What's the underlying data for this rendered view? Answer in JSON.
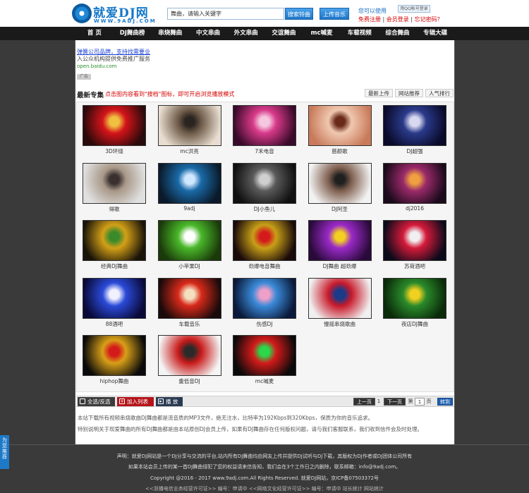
{
  "header": {
    "logo_text": "就爱DJ网",
    "logo_url_text": "WWW.9ADJ.COM",
    "search_value": "舞曲，请输入关键字",
    "search_button": "搜索铃曲",
    "upload_button": "上传音乐",
    "login_prompt": "您可以使用",
    "qq_login": "用QQ帐号登录",
    "register": "免费注册",
    "sep": "|",
    "member_login": "会员登录",
    "forgot": "忘记密码？"
  },
  "nav": [
    "首 页",
    "DJ舞曲榜",
    "串烧舞曲",
    "中文串曲",
    "外文串曲",
    "交谊舞曲",
    "mc喊麦",
    "车载视频",
    "综合舞曲",
    "专辑大碟"
  ],
  "ad": {
    "line1": "弹簧公司品牌，支持找需要业",
    "line2": "入公众机构提供免费推广服务",
    "line3": "open.baidu.com",
    "tag": "广告"
  },
  "section": {
    "title": "最新专集",
    "hint": "点击图内容看到\"搜档\"图标，即可开启浏览播放模式",
    "tabs": [
      "最新上传",
      "网站推荐",
      "人气排行"
    ]
  },
  "albums": [
    {
      "label": "3D环绕",
      "c1": "#2a0a0a",
      "c2": "#d4141a",
      "c3": "#f0c040"
    },
    {
      "label": "mc洪亮",
      "c1": "#e8ddd0",
      "c2": "#6e5a48",
      "c3": "#2a2420"
    },
    {
      "label": "7禾电音",
      "c1": "#3a0a2a",
      "c2": "#d83a8a",
      "c3": "#f6c8e0"
    },
    {
      "label": "慈颜歌",
      "c1": "#c87a5a",
      "c2": "#f0c8b0",
      "c3": "#6a2a1a"
    },
    {
      "label": "DJ超强",
      "c1": "#0a0a2a",
      "c2": "#2a3a8a",
      "c3": "#d8d8f0"
    },
    {
      "label": "得歌",
      "c1": "#e0e0e0",
      "c2": "#a89888",
      "c3": "#3a3030"
    },
    {
      "label": "9adj",
      "c1": "#0a1a2a",
      "c2": "#1a6aa8",
      "c3": "#d0e8ff"
    },
    {
      "label": "DJ小鱼儿",
      "c1": "#101010",
      "c2": "#5a5a5a",
      "c3": "#d0d0d0"
    },
    {
      "label": "DJ阿圣",
      "c1": "#f2f2f2",
      "c2": "#806050",
      "c3": "#202020"
    },
    {
      "label": "dj2016",
      "c1": "#1a0a1a",
      "c2": "#9a2a6a",
      "c3": "#f0a040"
    },
    {
      "label": "经典DJ舞曲",
      "c1": "#1a1408",
      "c2": "#d4a018",
      "c3": "#3a8a2a"
    },
    {
      "label": "小苹果DJ",
      "c1": "#1a3a0a",
      "c2": "#4ab82a",
      "c3": "#ffffff"
    },
    {
      "label": "劲爆电音舞曲",
      "c1": "#1a0a0a",
      "c2": "#c8a018",
      "c3": "#d41a1a"
    },
    {
      "label": "DJ舞曲 超劲爆",
      "c1": "#2a0a3a",
      "c2": "#9a2ac8",
      "c3": "#f4d020"
    },
    {
      "label": "苏荷酒吧",
      "c1": "#0a0a1a",
      "c2": "#d41a3a",
      "c3": "#f0f0f0"
    },
    {
      "label": "88酒吧",
      "c1": "#0a0a3a",
      "c2": "#2a4ad8",
      "c3": "#f0f0ff"
    },
    {
      "label": "车载音乐",
      "c1": "#1a0a0a",
      "c2": "#d82a1a",
      "c3": "#f4e0c0"
    },
    {
      "label": "伤感DJ",
      "c1": "#0a1a3a",
      "c2": "#3a8ad8",
      "c3": "#f0a0c8"
    },
    {
      "label": "慢摇串烧歌曲",
      "c1": "#f0f0f0",
      "c2": "#c81a2a",
      "c3": "#1a3a8a"
    },
    {
      "label": "夜店DJ舞曲",
      "c1": "#0a2a0a",
      "c2": "#2a8a2a",
      "c3": "#f0d020"
    },
    {
      "label": "hiphop舞曲",
      "c1": "#0a0a0a",
      "c2": "#d8a018",
      "c3": "#d41a1a"
    },
    {
      "label": "重低音DJ",
      "c1": "#f4f4f4",
      "c2": "#c81a1a",
      "c3": "#2a2a2a"
    },
    {
      "label": "mc喊麦",
      "c1": "#0a0a0a",
      "c2": "#d41a1a",
      "c3": "#2ad84a"
    }
  ],
  "toolbar": {
    "select_all": "全选/反选",
    "add_list": "加入列表",
    "play": "播 放",
    "prev": "上一页",
    "page_current": "1",
    "next": "下一页",
    "goto_prefix": "第",
    "goto_value": "1",
    "goto_suffix": "页",
    "go": "转到"
  },
  "notice": {
    "line1": "本站下载所有视频串烧歌曲DJ舞曲都是流音质的MP3文件，绝无注水，比特率为192Kbps到320Kbps，保质为你的音乐追求。",
    "line2": "特别说明关于现爱舞曲的所有DJ舞曲都是由本站原创DJ会员上传，如果有DJ舞曲存在任何版权问题，请与我们客服联系，我们收到信件会及时处理。"
  },
  "footer": {
    "line1": "声明：就爱DJ网站是一个DJ分享与交流的平台,站内所有DJ舞曲均由网友上传并提供DJ试听与DJ下载，其版权为DJ作者或DJ团体公司所有",
    "line2": "如果本站会员上传的某一首DJ舞曲侵犯了您的权益请来信告知，我们会在3个工作日之内删除，联系邮箱：info@9adj.com。",
    "line3": "Copyright @2016 - 2017 www.9adj.com.All Rights Reserved. 就爱DJ网站，京ICP备07503372号",
    "line4": "<<浙播电信业务经营许可证>> 编号：申请中   <<网络文化经营许可证>> 编号：申请中 站长统计 网站统计"
  },
  "side_tab": "为您推荐"
}
